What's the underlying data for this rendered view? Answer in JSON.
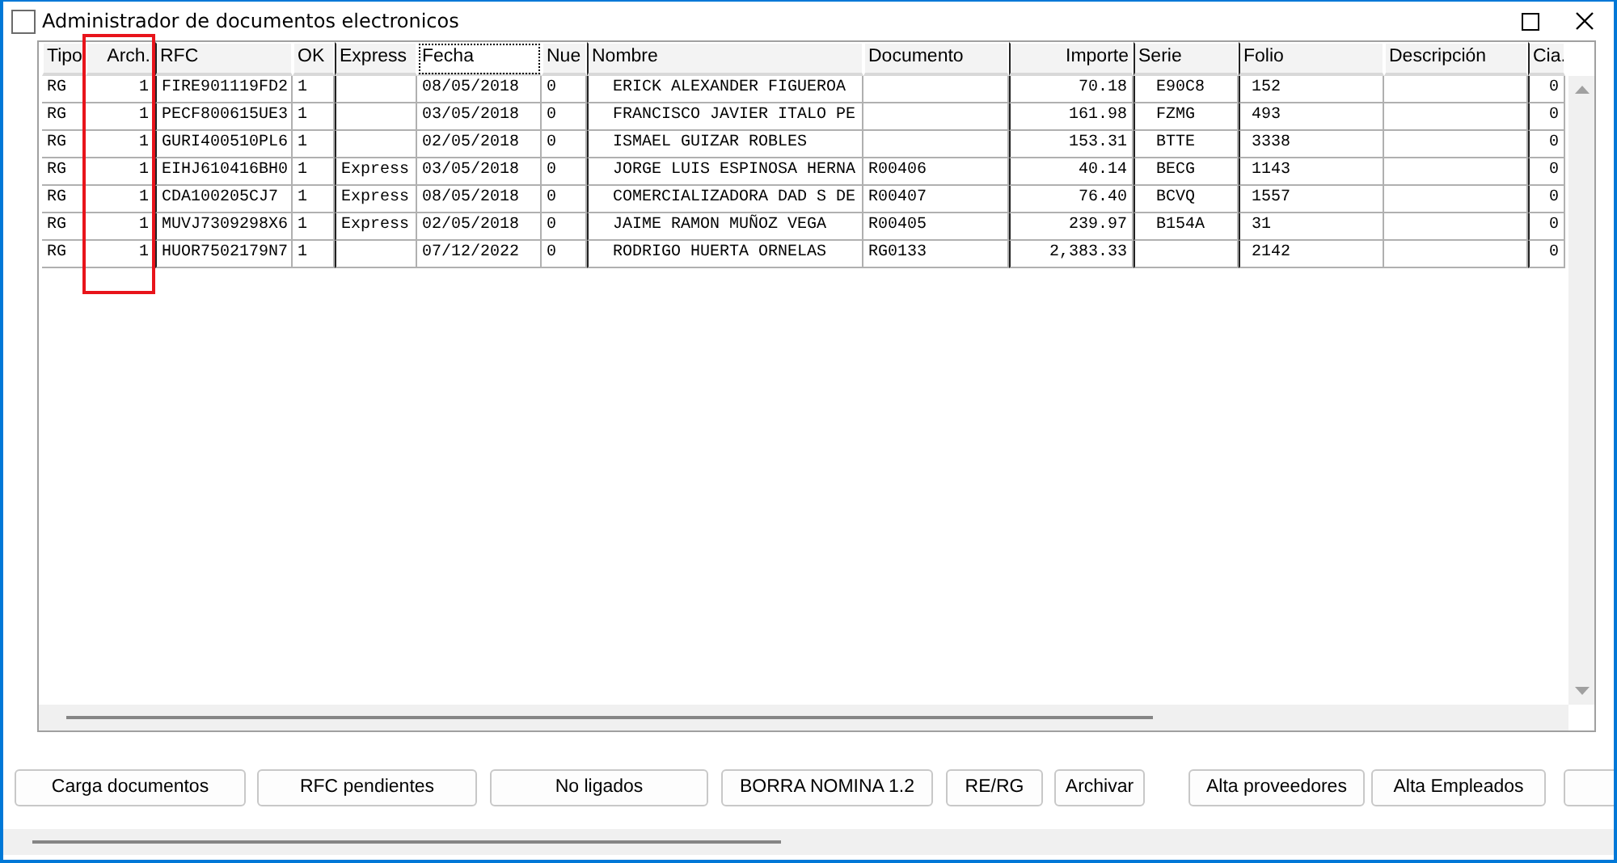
{
  "window": {
    "title": "Administrador de documentos electronicos"
  },
  "table": {
    "columns": [
      {
        "label": "Tipo",
        "highlighted": false,
        "focused": false
      },
      {
        "label": "Arch.",
        "highlighted": true,
        "focused": false
      },
      {
        "label": "RFC",
        "highlighted": false,
        "focused": false
      },
      {
        "label": "OK",
        "highlighted": false,
        "focused": false
      },
      {
        "label": "Express",
        "highlighted": false,
        "focused": false
      },
      {
        "label": "Fecha",
        "highlighted": false,
        "focused": true
      },
      {
        "label": "Nue",
        "highlighted": false,
        "focused": false
      },
      {
        "label": "Nombre",
        "highlighted": false,
        "focused": false
      },
      {
        "label": "Documento",
        "highlighted": false,
        "focused": false
      },
      {
        "label": "Importe",
        "highlighted": false,
        "focused": false
      },
      {
        "label": "Serie",
        "highlighted": false,
        "focused": false
      },
      {
        "label": "Folio",
        "highlighted": false,
        "focused": false
      },
      {
        "label": "Descripción",
        "highlighted": false,
        "focused": false
      },
      {
        "label": "Cia.",
        "highlighted": false,
        "focused": false
      }
    ],
    "rows": [
      [
        "RG",
        "1",
        "FIRE901119FD2",
        "1",
        null,
        "08/05/2018",
        "0",
        "ERICK ALEXANDER FIGUEROA",
        null,
        "70.18",
        "E90C8",
        "152",
        null,
        "0"
      ],
      [
        "RG",
        "1",
        "PECF800615UE3",
        "1",
        null,
        "03/05/2018",
        "0",
        "FRANCISCO JAVIER ITALO PE",
        null,
        "161.98",
        "FZMG",
        "493",
        null,
        "0"
      ],
      [
        "RG",
        "1",
        "GURI400510PL6",
        "1",
        null,
        "02/05/2018",
        "0",
        "ISMAEL GUIZAR ROBLES",
        null,
        "153.31",
        "BTTE",
        "3338",
        null,
        "0"
      ],
      [
        "RG",
        "1",
        "EIHJ610416BH0",
        "1",
        "Express",
        "03/05/2018",
        "0",
        "JORGE LUIS ESPINOSA HERNA",
        "R00406",
        "40.14",
        "BECG",
        "1143",
        null,
        "0"
      ],
      [
        "RG",
        "1",
        "CDA100205CJ7",
        "1",
        "Express",
        "08/05/2018",
        "0",
        "COMERCIALIZADORA DAD S DE",
        "R00407",
        "76.40",
        "BCVQ",
        "1557",
        null,
        "0"
      ],
      [
        "RG",
        "1",
        "MUVJ7309298X6",
        "1",
        "Express",
        "02/05/2018",
        "0",
        "JAIME RAMON MUÑOZ VEGA",
        "R00405",
        "239.97",
        "B154A",
        "31",
        null,
        "0"
      ],
      [
        "RG",
        "1",
        "HUOR7502179N7",
        "1",
        null,
        "07/12/2022",
        "0",
        "RODRIGO HUERTA ORNELAS",
        "RG0133",
        "2,383.33",
        null,
        "2142",
        null,
        "0"
      ]
    ]
  },
  "buttons": [
    "Carga documentos",
    "RFC pendientes",
    "No ligados",
    "BORRA NOMINA 1.2",
    "RE/RG",
    "Archivar",
    "Alta proveedores",
    "Alta Empleados"
  ]
}
